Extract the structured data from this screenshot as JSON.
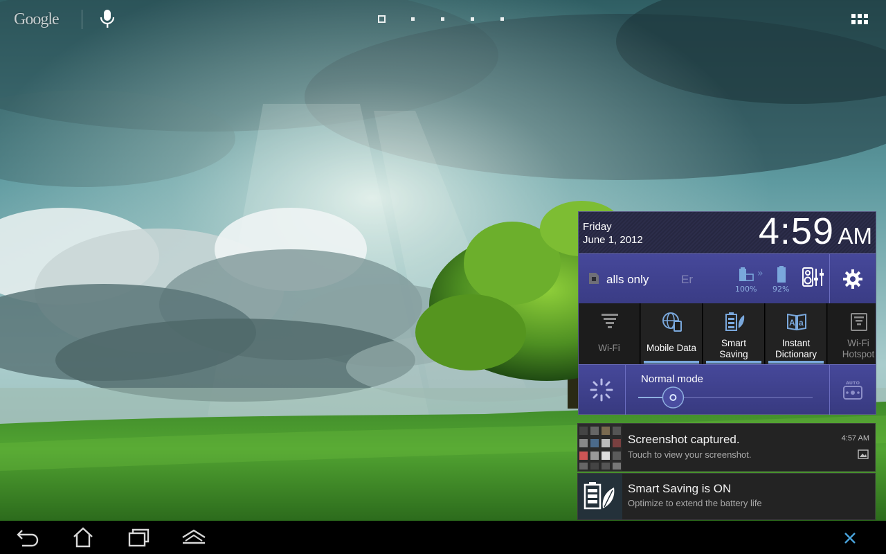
{
  "home": {
    "search_brand": "Google",
    "page_count": 5,
    "current_page": 1
  },
  "quick_settings": {
    "day": "Friday",
    "date": "June 1, 2012",
    "time": "4:59",
    "ampm": "AM",
    "carrier": "alls only",
    "carrier_faded": "Er",
    "battery_tablet": "100%",
    "battery_dock": "92%",
    "toggles": {
      "wifi": "Wi-Fi",
      "mobile_data": "Mobile Data",
      "smart_saving_1": "Smart",
      "smart_saving_2": "Saving",
      "dictionary_1": "Instant",
      "dictionary_2": "Dictionary",
      "hotspot_1": "Wi-Fi",
      "hotspot_2": "Hotspot"
    },
    "brightness_mode": "Normal mode",
    "brightness_level": 0.2,
    "auto_label": "AUTO"
  },
  "notifications": [
    {
      "title": "Screenshot captured.",
      "text": "Touch to view your screenshot.",
      "time": "4:57 AM"
    },
    {
      "title": "Smart Saving is ON",
      "text": "Optimize to extend the battery life"
    }
  ],
  "icons": [
    "microphone-icon",
    "apps-grid-icon",
    "settings-gear-icon",
    "back-icon",
    "home-icon",
    "recent-apps-icon",
    "menu-up-icon",
    "close-icon"
  ],
  "colors": {
    "accent": "#7aa8dc",
    "panel_purple": "#46489a",
    "notif_bg": "#232323"
  }
}
